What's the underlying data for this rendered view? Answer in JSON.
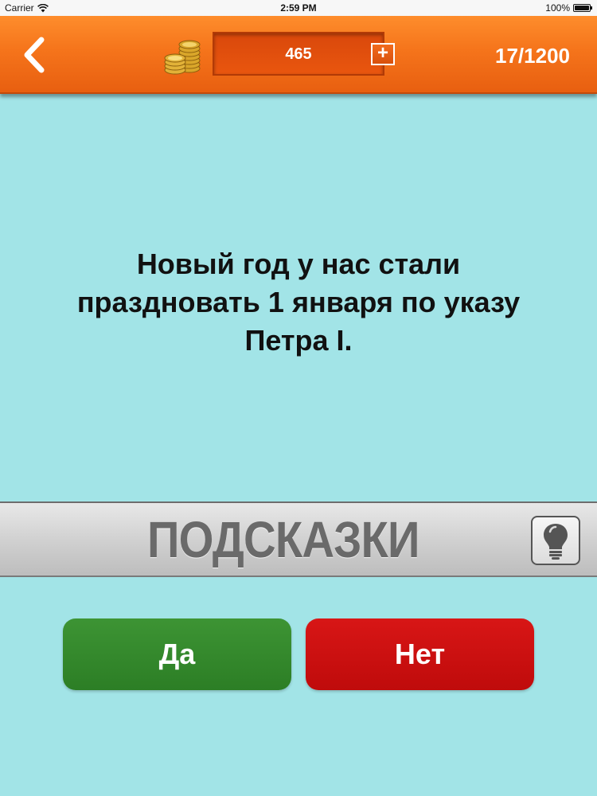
{
  "status_bar": {
    "carrier": "Carrier",
    "time": "2:59 PM",
    "battery": "100%"
  },
  "header": {
    "coins": "465",
    "add_label": "+",
    "progress": "17/1200"
  },
  "question": {
    "text": "Новый год у нас стали праздновать 1 января по указу Петра I."
  },
  "hints": {
    "label": "ПОДСКАЗКИ"
  },
  "answers": {
    "yes_label": "Да",
    "no_label": "Нет"
  },
  "colors": {
    "background": "#a2e4e7",
    "header_orange": "#f5741b",
    "yes_green": "#2f8a29",
    "no_red": "#cf1010"
  },
  "icons": {
    "back": "chevron-left-icon",
    "coins": "coins-stack-icon",
    "hint": "lightbulb-icon",
    "wifi": "wifi-icon",
    "battery": "battery-icon"
  }
}
